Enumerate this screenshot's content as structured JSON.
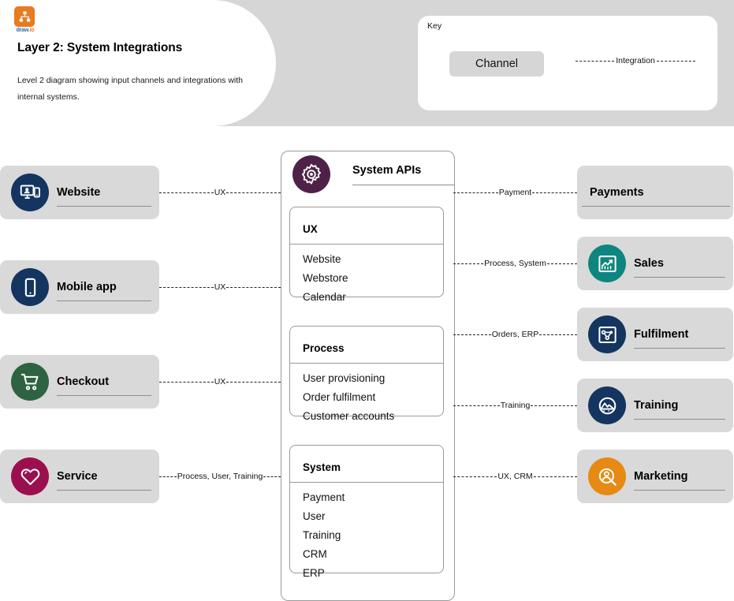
{
  "header": {
    "logo_name": "drawio-logo",
    "logo_text_draw": "draw",
    "logo_text_io": ".io",
    "title": "Layer 2: System Integrations",
    "subtitle": "Level 2 diagram showing input channels and integrations with internal systems."
  },
  "key": {
    "label": "Key",
    "channel_label": "Channel",
    "integration_label": "Integration"
  },
  "colors": {
    "band_gray": "#d6d6d6",
    "card_gray": "#d9d9d9",
    "navy": "#13355f",
    "green": "#2e6341",
    "crimson": "#9c0f4e",
    "teal": "#0f857f",
    "purple": "#4e2248",
    "orange": "#e68a14",
    "logo_orange": "#e87b1e"
  },
  "channels": [
    {
      "id": "website",
      "label": "Website",
      "icon": "monitor-person-icon",
      "icon_color": "#13355f",
      "has_icon": true
    },
    {
      "id": "mobile-app",
      "label": "Mobile app",
      "icon": "smartphone-icon",
      "icon_color": "#13355f",
      "has_icon": true
    },
    {
      "id": "checkout",
      "label": "Checkout",
      "icon": "shopping-cart-icon",
      "icon_color": "#2e6341",
      "has_icon": true
    },
    {
      "id": "service",
      "label": "Service",
      "icon": "heart-icon",
      "icon_color": "#9c0f4e",
      "has_icon": true
    }
  ],
  "systems": [
    {
      "id": "payments",
      "label": "Payments",
      "icon": "",
      "icon_color": "",
      "has_icon": false
    },
    {
      "id": "sales",
      "label": "Sales",
      "icon": "chart-growth-icon",
      "icon_color": "#0f857f",
      "has_icon": true
    },
    {
      "id": "fulfilment",
      "label": "Fulfilment",
      "icon": "flow-nodes-icon",
      "icon_color": "#13355f",
      "has_icon": true
    },
    {
      "id": "training",
      "label": "Training",
      "icon": "mountain-dome-icon",
      "icon_color": "#13355f",
      "has_icon": true
    },
    {
      "id": "marketing",
      "label": "Marketing",
      "icon": "person-search-icon",
      "icon_color": "#e68a14",
      "has_icon": true
    }
  ],
  "api_panel": {
    "header_label": "System APIs",
    "header_icon": "gear-icon",
    "header_icon_color": "#4e2248",
    "groups": [
      {
        "id": "ux",
        "title": "UX",
        "items": [
          "Website",
          "Webstore",
          "Calendar"
        ]
      },
      {
        "id": "process",
        "title": "Process",
        "items": [
          "User provisioning",
          "Order fulfilment",
          "Customer accounts"
        ]
      },
      {
        "id": "system",
        "title": "System",
        "items": [
          "Payment",
          "User",
          "Training",
          "CRM",
          "ERP"
        ]
      }
    ]
  },
  "connectors_left": [
    {
      "id": "website-to-api",
      "label": "UX"
    },
    {
      "id": "mobile-app-to-api",
      "label": "UX"
    },
    {
      "id": "checkout-to-api",
      "label": "UX"
    },
    {
      "id": "service-to-api",
      "label": "Process, User, Training"
    }
  ],
  "connectors_right": [
    {
      "id": "api-to-payments",
      "label": "Payment"
    },
    {
      "id": "api-to-sales",
      "label": "Process, System"
    },
    {
      "id": "api-to-fulfilment",
      "label": "Orders, ERP"
    },
    {
      "id": "api-to-training",
      "label": "Training"
    },
    {
      "id": "api-to-marketing",
      "label": "UX, CRM"
    }
  ]
}
